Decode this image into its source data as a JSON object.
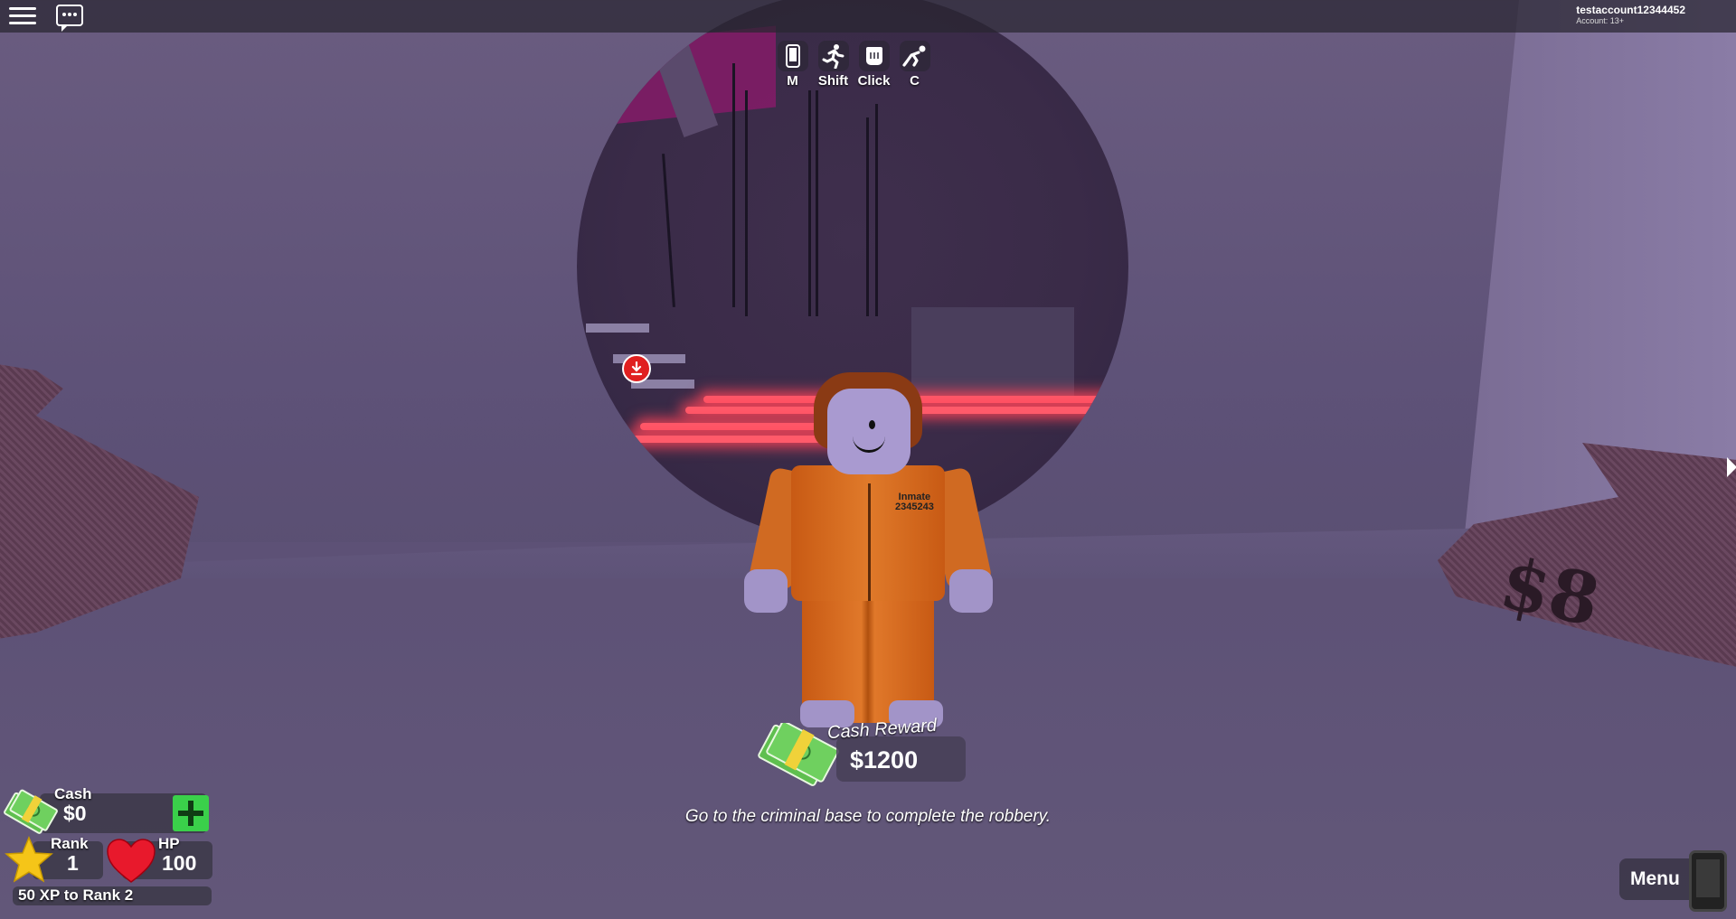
{
  "account": {
    "username": "testaccount12344452",
    "age_label": "Account: 13+"
  },
  "actions": [
    {
      "key": "M",
      "icon": "phone-icon"
    },
    {
      "key": "Shift",
      "icon": "running-icon"
    },
    {
      "key": "Click",
      "icon": "fist-icon"
    },
    {
      "key": "C",
      "icon": "crouch-icon"
    }
  ],
  "character": {
    "shirt_text": "Inmate\n2345243"
  },
  "cash_reward": {
    "label": "Cash Reward",
    "value": "$1200"
  },
  "objective": "Go to the criminal base to complete the robbery.",
  "hud": {
    "cash_label": "Cash",
    "cash_value": "$0",
    "rank_label": "Rank",
    "rank_value": "1",
    "hp_label": "HP",
    "hp_value": "100",
    "xp_text": "50 XP to Rank 2",
    "xp_progress": 0
  },
  "bag_text": "$8",
  "menu": {
    "label": "Menu"
  },
  "colors": {
    "laser": "#ff5a6a",
    "cash_plus": "#3ad04a",
    "marker": "#e02020",
    "jumpsuit": "#e07a2a"
  }
}
